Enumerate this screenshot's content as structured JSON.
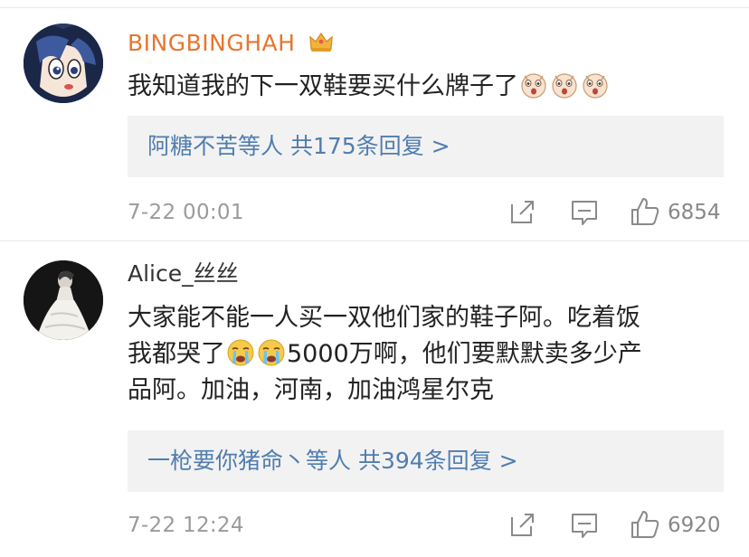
{
  "comments": [
    {
      "username": "BINGBINGHAH",
      "verified_badge_icon": "crown-icon",
      "content_lines": [
        "我知道我的下一双鞋要买什么牌子了"
      ],
      "emojis": [
        "face-emoji",
        "face-emoji",
        "face-emoji"
      ],
      "reply_summary": "阿糖不苦等人 共175条回复 >",
      "time": "7-22 00:01",
      "like_count": "6854",
      "actions": [
        "share-icon",
        "comment-icon",
        "like-icon"
      ]
    },
    {
      "username": "Alice_丝丝",
      "content_line1": "大家能不能一人买一双他们家的鞋子阿。吃着饭",
      "content_line2_a": "我都哭了",
      "content_line2_emojis": [
        "crying-emoji",
        "crying-emoji"
      ],
      "content_line2_b": "5000万啊，他们要默默卖多少产",
      "content_line3": "品阿。加油，河南，加油鸿星尔克",
      "reply_summary": "一枪要你猪命丶等人 共394条回复 >",
      "time": "7-22 12:24",
      "like_count": "6920",
      "actions": [
        "share-icon",
        "comment-icon",
        "like-icon"
      ]
    }
  ],
  "colors": {
    "username_highlight": "#e6762e",
    "reply_link": "#507daf",
    "reply_bg": "#f2f2f2",
    "meta_text": "#9b9b9b"
  }
}
